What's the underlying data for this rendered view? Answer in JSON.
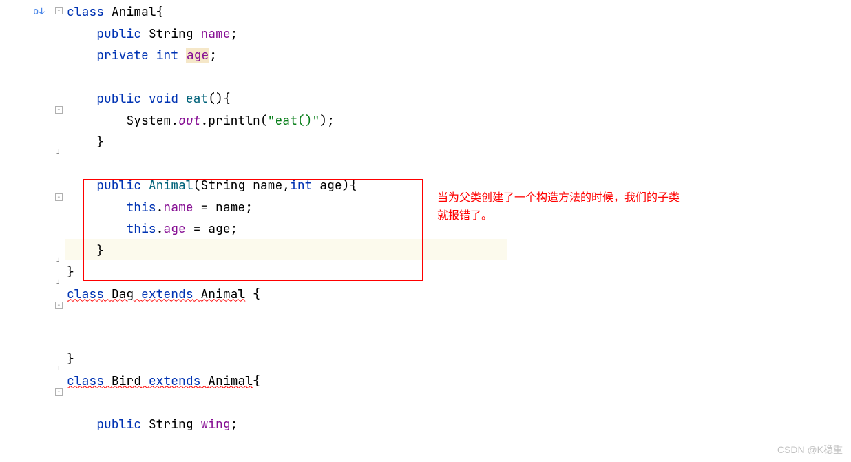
{
  "code": {
    "line1": {
      "kw_class": "class",
      "name": "Animal",
      "brace": "{"
    },
    "line2": {
      "kw_public": "public",
      "type": "String",
      "field": "name",
      "semi": ";"
    },
    "line3": {
      "kw_private": "private",
      "kw_int": "int",
      "field": "age",
      "semi": ";"
    },
    "line5": {
      "kw_public": "public",
      "kw_void": "void",
      "method": "eat",
      "parens": "(){"
    },
    "line6": {
      "sys": "System",
      "dot1": ".",
      "out": "out",
      "dot2": ".",
      "println": "println",
      "open": "(",
      "str": "\"eat()\"",
      "close": ");"
    },
    "line7": {
      "brace": "}"
    },
    "line9": {
      "kw_public": "public",
      "ctor": "Animal",
      "open": "(",
      "type1": "String",
      "param1": " name,",
      "kw_int": "int",
      "param2": " age){"
    },
    "line10": {
      "kw_this": "this",
      "dot": ".",
      "field": "name",
      "eq": " = name;"
    },
    "line11": {
      "kw_this": "this",
      "dot": ".",
      "field": "age",
      "eq": " = age;"
    },
    "line12": {
      "brace": "}"
    },
    "line13": {
      "brace": "}"
    },
    "line14": {
      "kw_class": "class",
      "sp1": " ",
      "name": "Dag",
      "sp2": " ",
      "kw_extends": "extends",
      "sp3": " ",
      "parent": "Animal",
      "rest": " {"
    },
    "line17": {
      "brace": "}"
    },
    "line18": {
      "kw_class": "class",
      "sp1": " ",
      "name": "Bird",
      "sp2": " ",
      "kw_extends": "extends",
      "sp3": " ",
      "parent": "Animal",
      "rest": "{"
    },
    "line20": {
      "kw_public": "public",
      "type": "String",
      "field": "wing",
      "semi": ";"
    }
  },
  "annotation": {
    "line1": "当为父类创建了一个构造方法的时候，我们的子类",
    "line2": "就报错了。"
  },
  "watermark": "CSDN @K稳重",
  "icons": {
    "override": "o↓",
    "fold_minus": "−",
    "fold_end": "┘"
  }
}
